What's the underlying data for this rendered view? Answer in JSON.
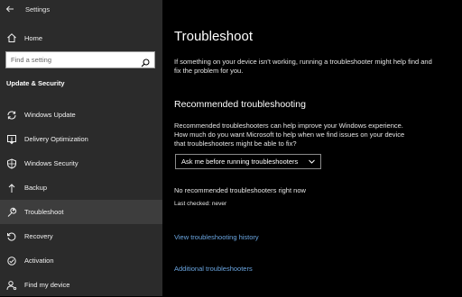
{
  "window": {
    "title": "Settings"
  },
  "sidebar": {
    "home_label": "Home",
    "search_placeholder": "Find a setting",
    "section_header": "Update & Security",
    "items": [
      {
        "label": "Windows Update",
        "icon": "sync-icon"
      },
      {
        "label": "Delivery Optimization",
        "icon": "delivery-optimization-icon"
      },
      {
        "label": "Windows Security",
        "icon": "shield-icon"
      },
      {
        "label": "Backup",
        "icon": "backup-arrow-icon"
      },
      {
        "label": "Troubleshoot",
        "icon": "wrench-icon",
        "selected": true
      },
      {
        "label": "Recovery",
        "icon": "recovery-icon"
      },
      {
        "label": "Activation",
        "icon": "activation-icon"
      },
      {
        "label": "Find my device",
        "icon": "person-location-icon"
      }
    ]
  },
  "main": {
    "title": "Troubleshoot",
    "intro": "If something on your device isn't working, running a troubleshooter might help find and fix the problem for you.",
    "recommended": {
      "title": "Recommended troubleshooting",
      "description": "Recommended troubleshooters can help improve your Windows experience. How much do you want Microsoft to help when we find issues on your device that troubleshooters might be able to fix?",
      "dropdown_value": "Ask me before running troubleshooters",
      "status": "No recommended troubleshooters right now",
      "last_checked": "Last checked: never"
    },
    "history_link": "View troubleshooting history",
    "additional_link": "Additional troubleshooters"
  },
  "colors": {
    "sidebar_bg": "#2b2b2b",
    "selected_bg": "#3d3d3d",
    "main_bg": "#000000",
    "link": "#6aa5e0"
  }
}
